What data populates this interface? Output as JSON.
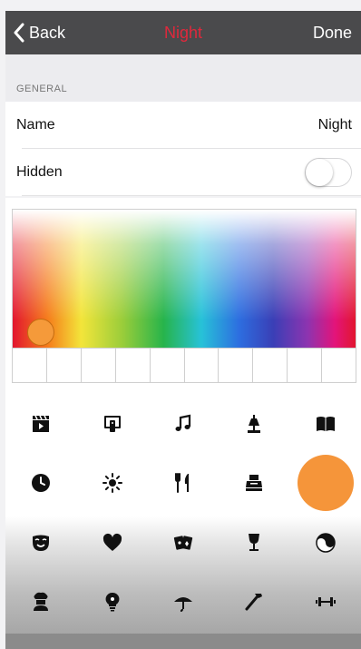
{
  "nav": {
    "back_label": "Back",
    "title": "Night",
    "done_label": "Done",
    "title_color": "#e0283c"
  },
  "section": {
    "general_label": "GENERAL"
  },
  "rows": {
    "name_label": "Name",
    "name_value": "Night",
    "hidden_label": "Hidden",
    "hidden_on": false
  },
  "picker": {
    "handle_color": "#f59a3a",
    "swatch_count": 10
  },
  "icons": [
    "clapperboard-icon",
    "tv-remote-icon",
    "music-note-icon",
    "lamp-icon",
    "book-icon",
    "clock-icon",
    "sun-icon",
    "fork-knife-icon",
    "cash-register-icon",
    "moon-icon",
    "mask-icon",
    "heart-icon",
    "playing-cards-icon",
    "wine-glass-icon",
    "yin-yang-icon",
    "chef-icon",
    "lightbulb-icon",
    "umbrella-icon",
    "hammer-icon",
    "dumbbell-icon"
  ],
  "selected_icon": "moon-icon",
  "selected_color": "#f5953a"
}
